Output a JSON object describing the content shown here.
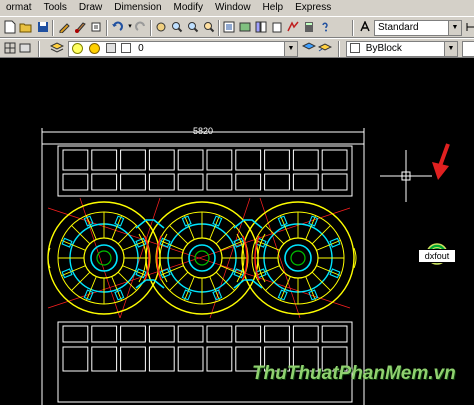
{
  "menu": {
    "items": [
      "ormat",
      "Tools",
      "Draw",
      "Dimension",
      "Modify",
      "Window",
      "Help",
      "Express"
    ]
  },
  "toolbar": {
    "text_style": "Standard",
    "layer_name": "0",
    "color_value": "ByBlock"
  },
  "drawing": {
    "dimension_label": "5820",
    "command_text": "dxfout"
  },
  "watermark": {
    "text": "ThuThuatPhanMem.vn"
  },
  "colors": {
    "ui_gray": "#d4d0c8",
    "drawing_white": "#ffffff",
    "drawing_yellow": "#ffff00",
    "drawing_cyan": "#00e5ff",
    "drawing_red": "#ff2020",
    "drawing_green": "#00c000",
    "arrow_red": "#e02020"
  }
}
